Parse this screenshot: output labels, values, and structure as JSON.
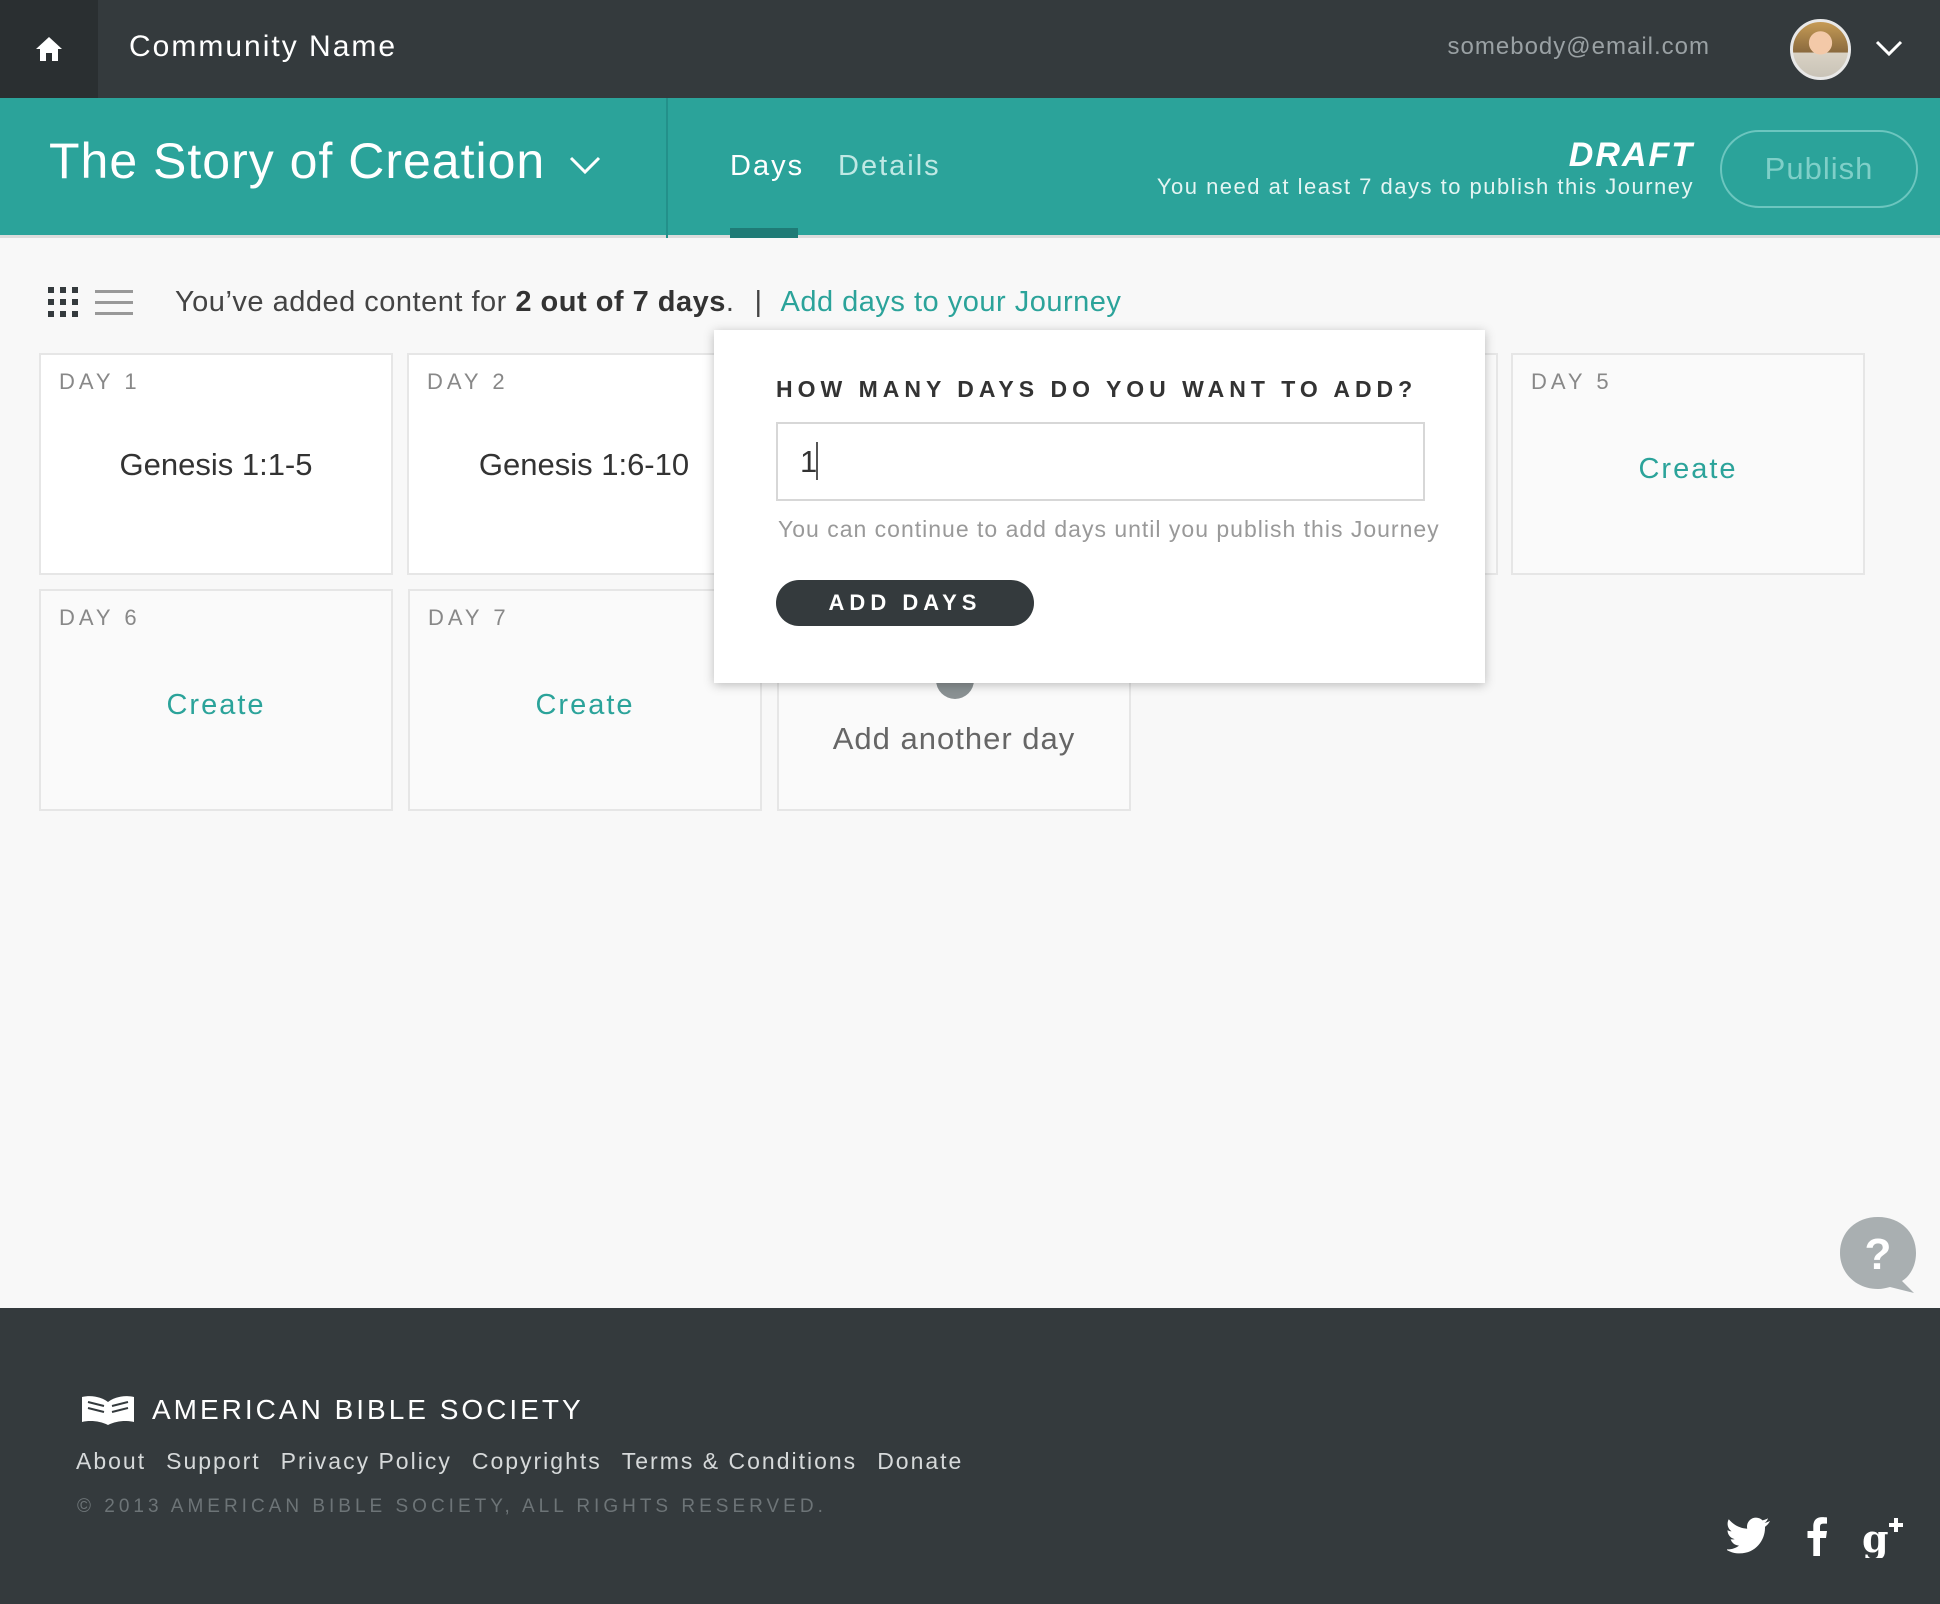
{
  "topbar": {
    "community_name": "Community Name",
    "email": "somebody@email.com"
  },
  "journey": {
    "title": "The Story of Creation",
    "tabs": [
      {
        "label": "Days",
        "active": true
      },
      {
        "label": "Details",
        "active": false
      }
    ],
    "status": "DRAFT",
    "status_note": "You need at least 7 days to publish this Journey",
    "publish_label": "Publish"
  },
  "summary": {
    "prefix": "You’ve added content for ",
    "count": "2 out of 7 days",
    "suffix": ".",
    "separator": "|",
    "add_link": "Add days to your Journey"
  },
  "days": [
    {
      "label": "DAY 1",
      "title": "Genesis 1:1-5"
    },
    {
      "label": "DAY 2",
      "title": "Genesis 1:6-10"
    },
    {
      "label": "DAY 5",
      "action": "Create"
    },
    {
      "label": "DAY 6",
      "action": "Create"
    },
    {
      "label": "DAY 7",
      "action": "Create"
    }
  ],
  "add_another_label": "Add another day",
  "popover": {
    "question": "HOW MANY DAYS DO YOU WANT TO ADD?",
    "input_value": "1",
    "hint": "You can continue to add days until you publish this Journey",
    "button_label": "ADD DAYS"
  },
  "footer": {
    "org_name": "AMERICAN BIBLE SOCIETY",
    "links": [
      "About",
      "Support",
      "Privacy Policy",
      "Copyrights",
      "Terms & Conditions",
      "Donate"
    ],
    "copyright": "© 2013 AMERICAN BIBLE SOCIETY, ALL RIGHTS RESERVED.",
    "social": [
      "twitter-icon",
      "facebook-icon",
      "google-plus-icon"
    ]
  },
  "colors": {
    "accent": "#2ba39a",
    "dark": "#343a3d",
    "background": "#f8f8f8"
  }
}
